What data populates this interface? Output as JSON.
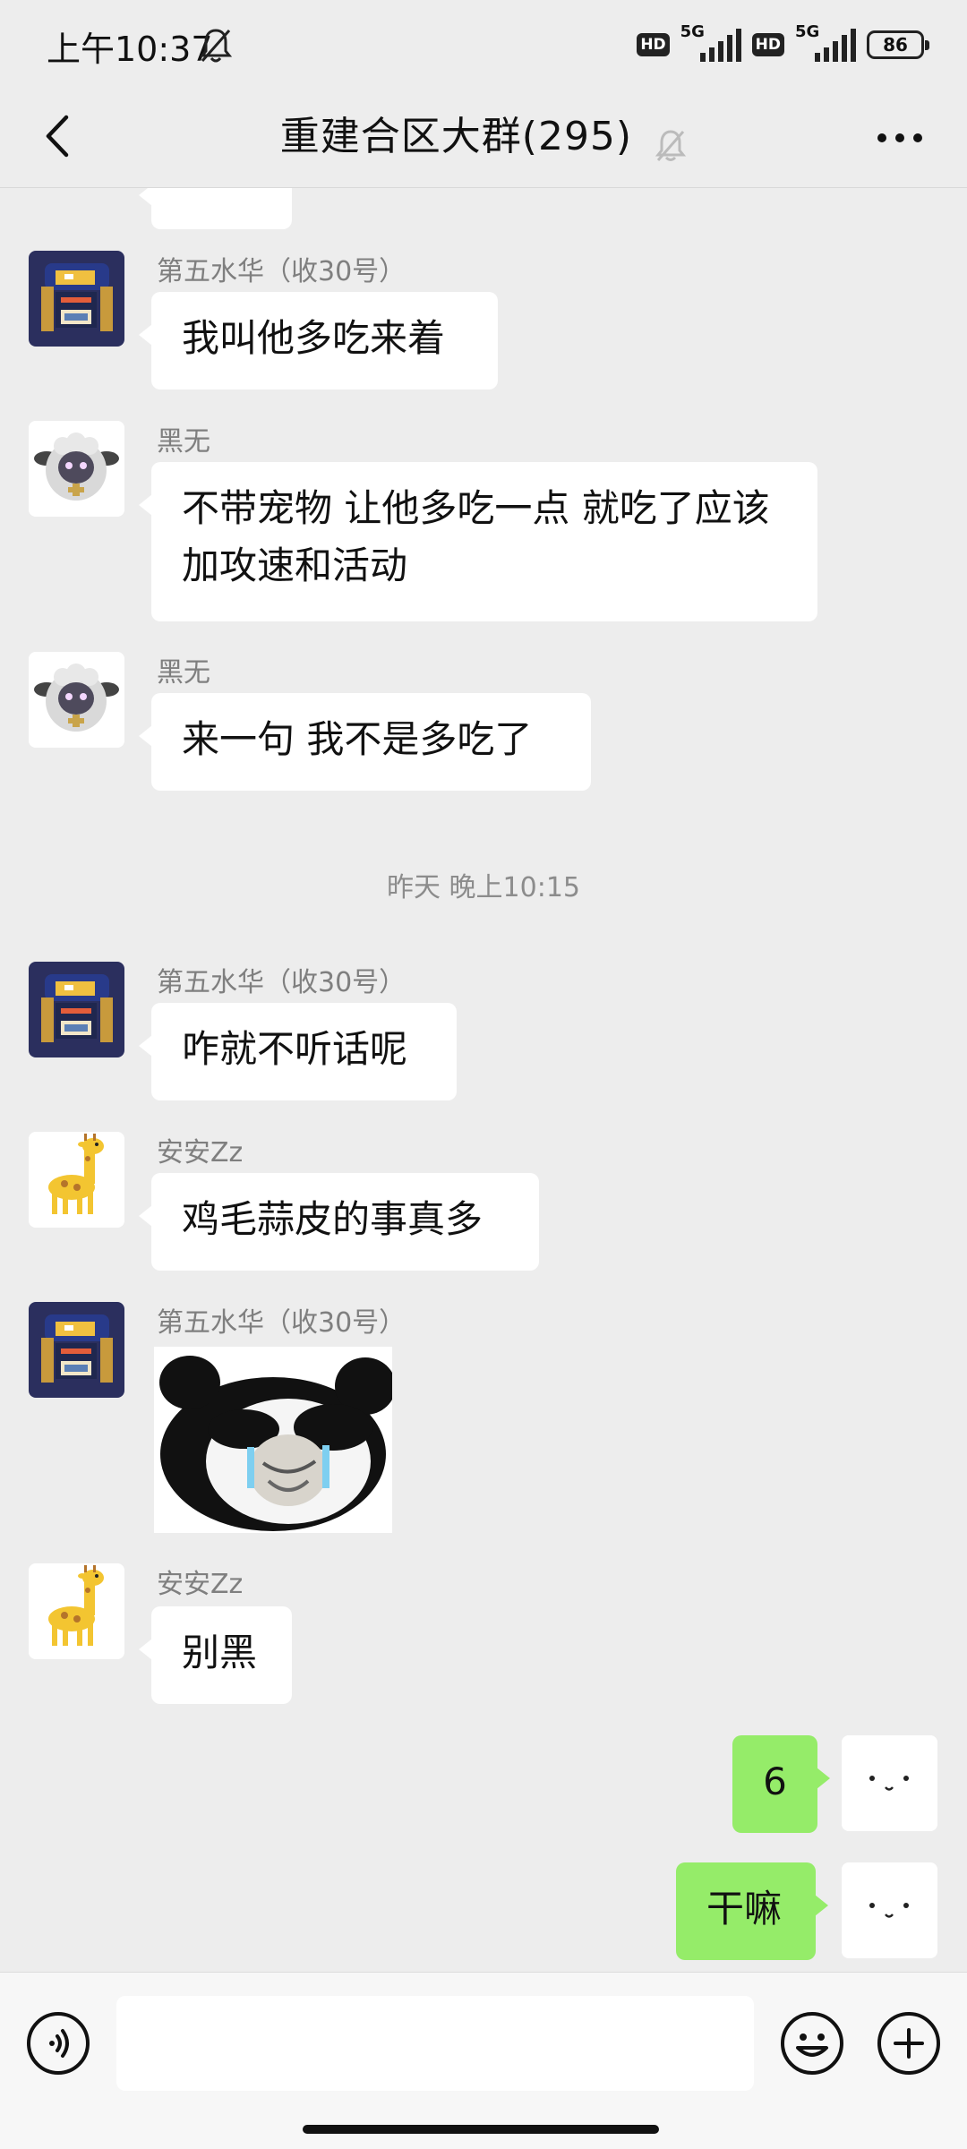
{
  "status_bar": {
    "time": "上午10:37",
    "hd1": "HD",
    "net1": "5G",
    "hd2": "HD",
    "net2": "5G",
    "battery": "86",
    "icons": [
      "bell-off-icon",
      "signal-icon",
      "battery-icon"
    ]
  },
  "header": {
    "title": "重建合区大群(295)",
    "icons": [
      "back-icon",
      "bell-off-icon",
      "more-icon"
    ]
  },
  "messages": [
    {
      "sender": "",
      "text": "",
      "avatar": "partial-bubble"
    },
    {
      "sender": "第五水华（收30号）",
      "text": "我叫他多吃来着",
      "avatar": "dark-knight-avatar"
    },
    {
      "sender": "黑无",
      "text": "不带宠物 让他多吃一点 就吃了应该加攻速和活动",
      "avatar": "sheep-avatar"
    },
    {
      "sender": "黑无",
      "text": "来一句 我不是多吃了",
      "avatar": "sheep-avatar"
    },
    {
      "timestamp": "昨天 晚上10:15"
    },
    {
      "sender": "第五水华（收30号）",
      "text": "咋就不听话呢",
      "avatar": "dark-knight-avatar"
    },
    {
      "sender": "安安Zz",
      "text": "鸡毛蒜皮的事真多",
      "avatar": "giraffe-avatar"
    },
    {
      "sender": "第五水华（收30号）",
      "sticker": "panda-meme-sticker",
      "avatar": "dark-knight-avatar"
    },
    {
      "sender": "安安Zz",
      "text": "别黑",
      "avatar": "giraffe-avatar"
    },
    {
      "sender": "me",
      "text": "6",
      "avatar": "face-avatar"
    },
    {
      "sender": "me",
      "text": "干嘛",
      "avatar": "face-avatar"
    }
  ],
  "input_bar": {
    "placeholder": "",
    "icons": [
      "voice-icon",
      "emoji-icon",
      "plus-icon"
    ]
  },
  "colors": {
    "background": "#ededed",
    "self_bubble": "#95ec69",
    "other_bubble": "#ffffff",
    "sender_name": "#7f7f7f"
  }
}
